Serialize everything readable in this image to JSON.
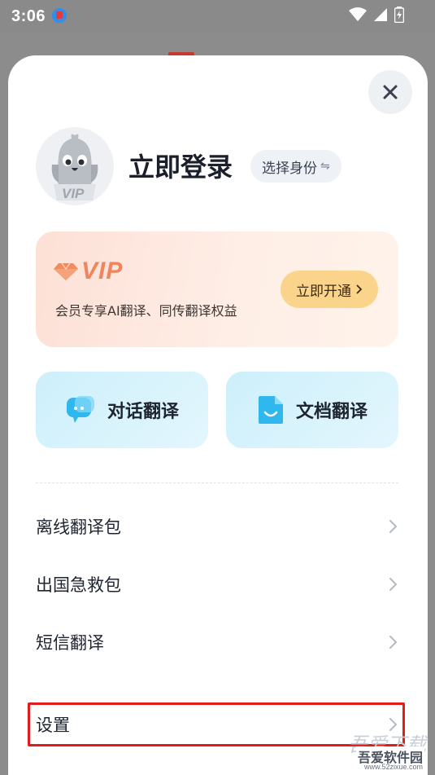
{
  "status_bar": {
    "time": "3:06"
  },
  "header": {
    "login_title": "立即登录",
    "identity_chip": "选择身份"
  },
  "vip": {
    "logo_text": "VIP",
    "description": "会员专享AI翻译、同传翻译权益",
    "button_label": "立即开通"
  },
  "features": [
    {
      "label": "对话翻译"
    },
    {
      "label": "文档翻译"
    }
  ],
  "menu": [
    {
      "label": "离线翻译包"
    },
    {
      "label": "出国急救包"
    },
    {
      "label": "短信翻译"
    },
    {
      "label": "设置"
    }
  ],
  "avatar_badge": "VIP",
  "watermark": {
    "title": "吾爱下载",
    "name": "吾爱软件园",
    "url": "www.52zixue.com"
  },
  "colors": {
    "vip_accent": "#f0845c",
    "highlight": "#e01c1c",
    "feature_bg": "#cdf0fb"
  }
}
